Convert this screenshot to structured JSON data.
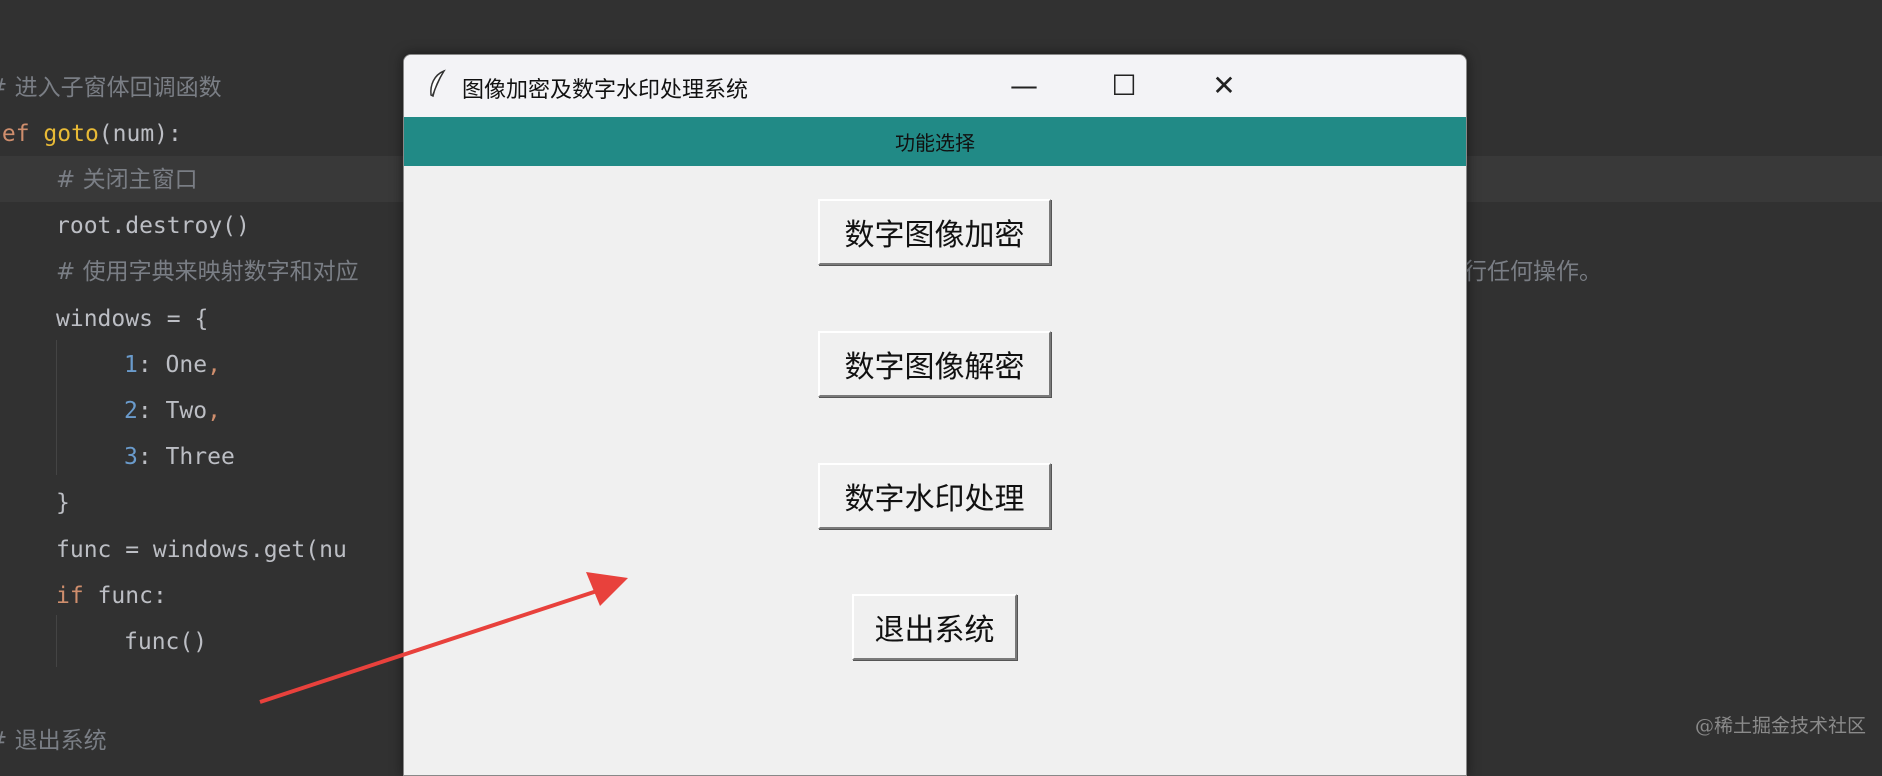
{
  "editor": {
    "lines": [
      {
        "text": "# 进入子窗体回调函数"
      },
      {
        "kw": "def",
        "fn": "goto",
        "rest": "(num):"
      },
      {
        "text": "# 关闭主窗口"
      },
      {
        "text": "root.destroy()"
      },
      {
        "text": "# 使用字典来映射数字和对应",
        "tail": "行任何操作。"
      },
      {
        "text": "windows = {"
      },
      {
        "num": "1",
        "rest": ": One",
        "comma": ","
      },
      {
        "num": "2",
        "rest": ": Two",
        "comma": ","
      },
      {
        "num": "3",
        "rest": ": Three"
      },
      {
        "text": "}"
      },
      {
        "text": "func = windows.get(nu"
      },
      {
        "kw": "if",
        "rest": " func:"
      },
      {
        "text": "func()"
      },
      {
        "text": "# 退出系统"
      }
    ]
  },
  "window": {
    "title": "图像加密及数字水印处理系统",
    "banner": "功能选择",
    "buttons": [
      "数字图像加密",
      "数字图像解密",
      "数字水印处理",
      "退出系统"
    ],
    "controls": {
      "minimize": "—",
      "maximize": "☐",
      "close": "✕"
    },
    "banner_color": "#218a86"
  },
  "watermark": "@稀土掘金技术社区",
  "arrow_color": "#e8413c"
}
